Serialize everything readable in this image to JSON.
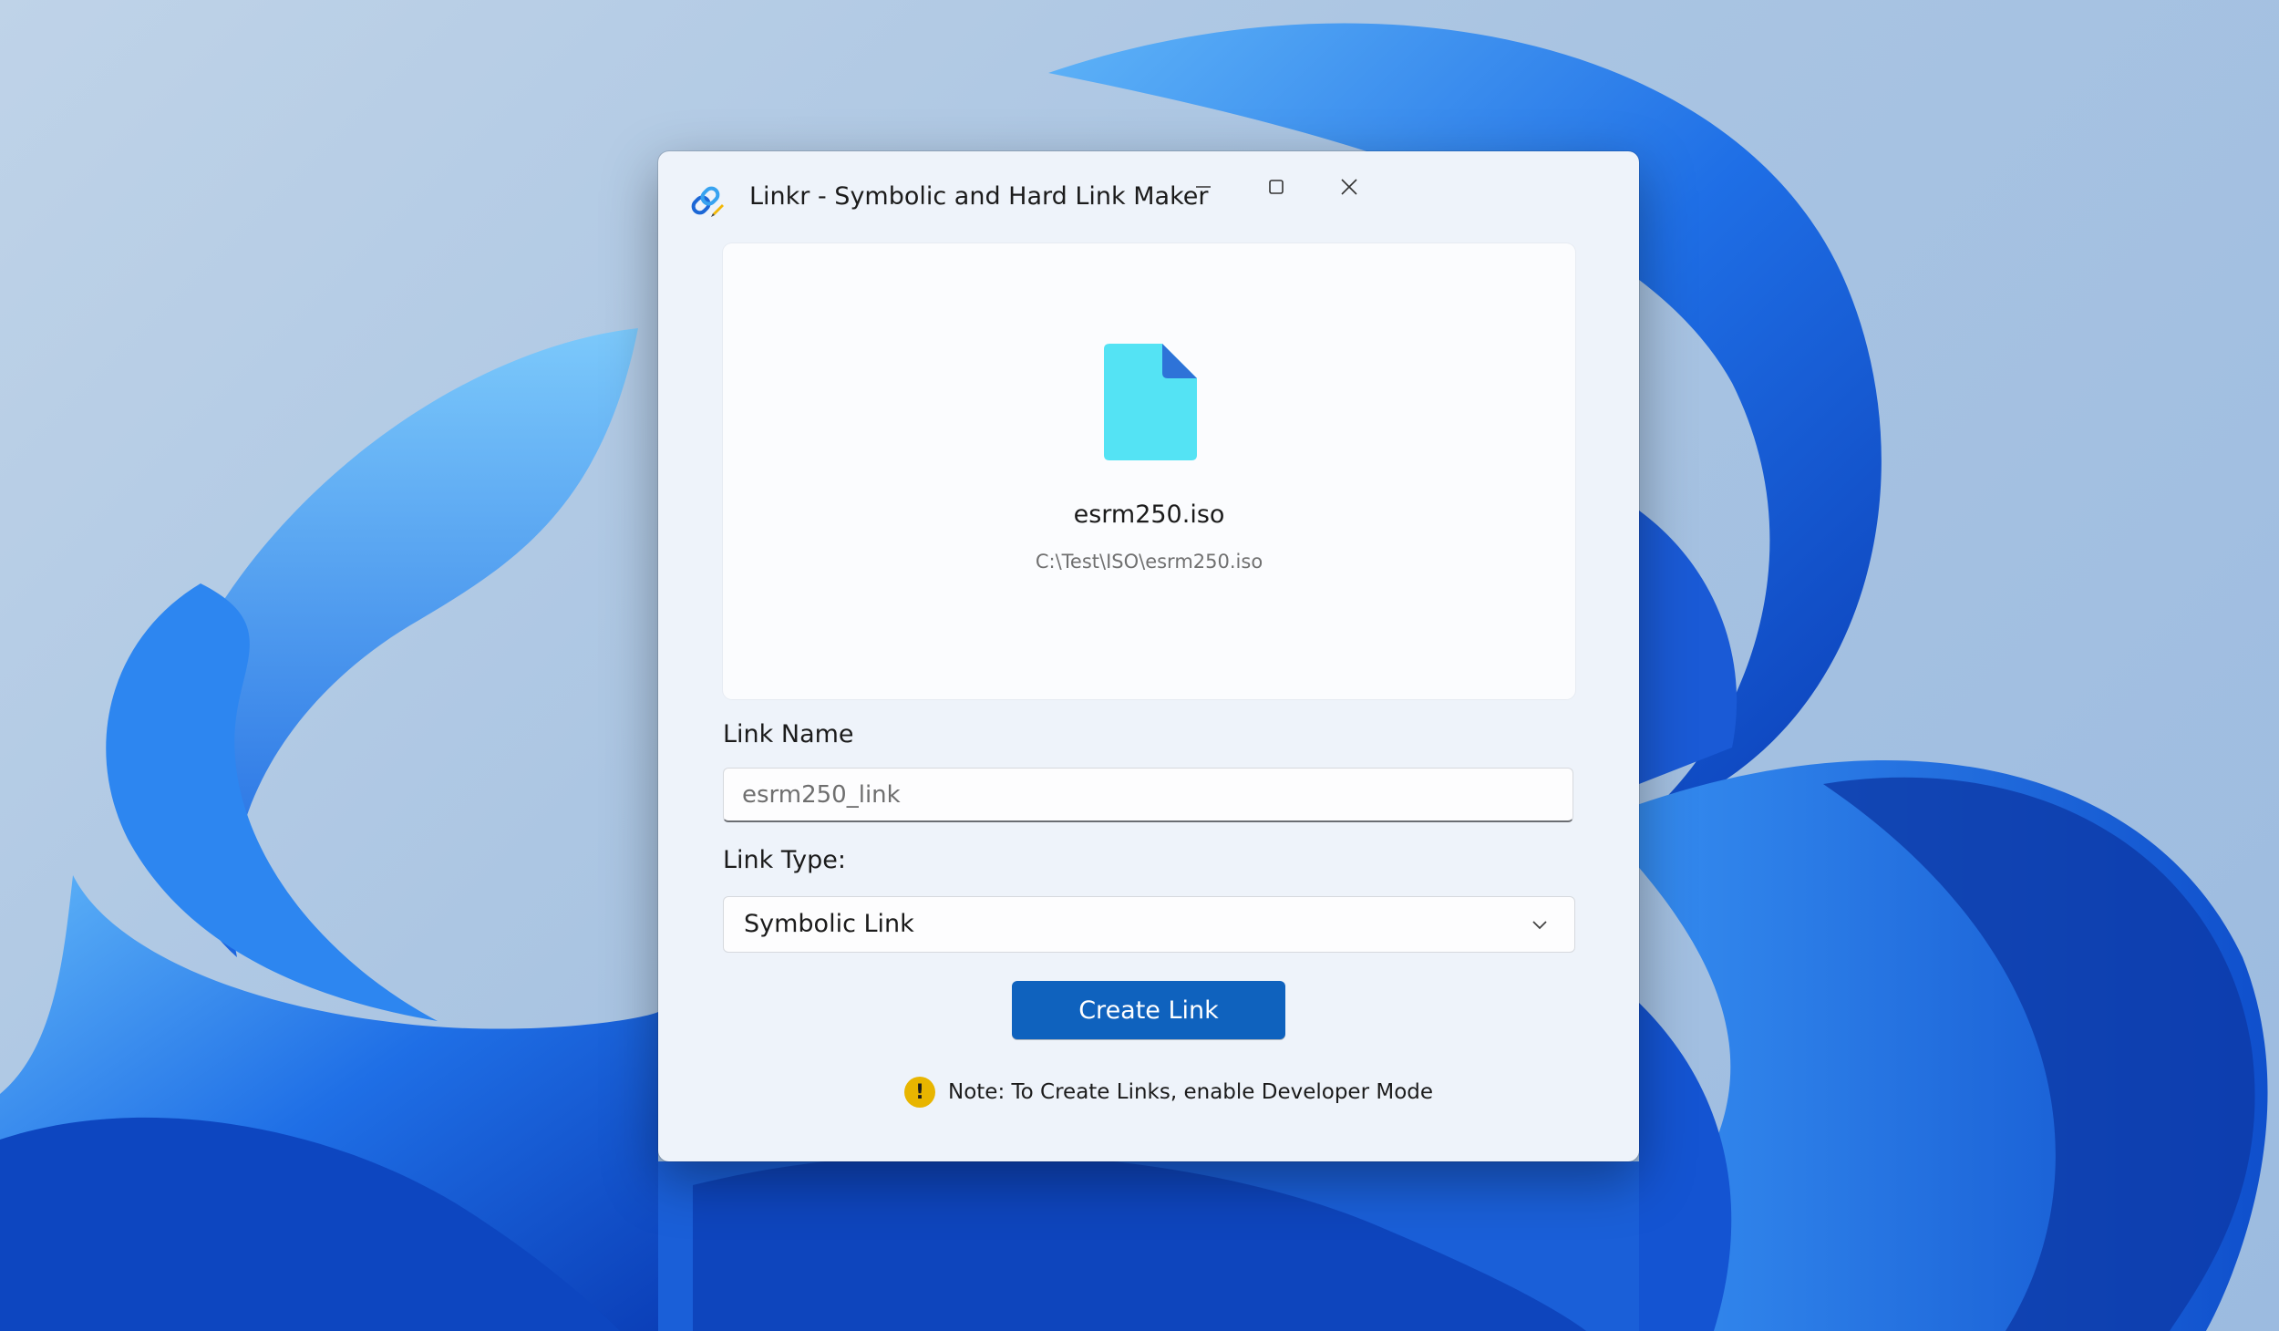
{
  "window": {
    "title": "Linkr - Symbolic and Hard Link Maker",
    "icon": "chain-link-icon",
    "controls": [
      "minimize-icon",
      "maximize-icon",
      "close-icon"
    ]
  },
  "preview": {
    "icon": "file-icon",
    "file_name": "esrm250.iso",
    "file_path": "C:\\Test\\ISO\\esrm250.iso"
  },
  "form": {
    "link_name_label": "Link Name",
    "link_name_value": "",
    "link_name_placeholder": "esrm250_link",
    "link_type_label": "Link Type:",
    "link_type_selected": "Symbolic Link",
    "create_button": "Create Link"
  },
  "note": {
    "icon": "warning-icon",
    "icon_glyph": "!",
    "text": "Note: To Create Links, enable Developer Mode"
  },
  "colors": {
    "accent": "#0f62be",
    "file_icon": "#54e3f4",
    "file_fold": "#2e73d8",
    "warning": "#e8b500",
    "window_bg": "#eef3fa"
  }
}
